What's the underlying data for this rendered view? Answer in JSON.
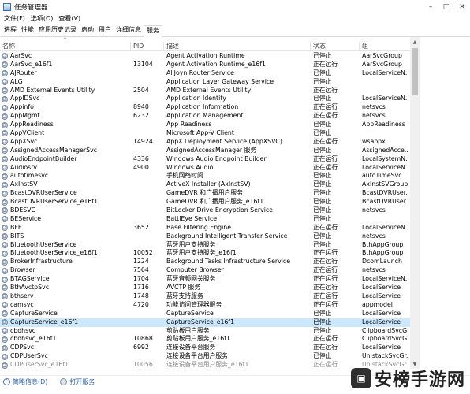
{
  "window": {
    "title": "任务管理器",
    "minimize": "–",
    "maximize": "□",
    "close": "✕"
  },
  "menu": [
    "文件(F)",
    "选项(O)",
    "查看(V)"
  ],
  "tabs": [
    {
      "label": "进程",
      "active": false
    },
    {
      "label": "性能",
      "active": false
    },
    {
      "label": "应用历史记录",
      "active": false
    },
    {
      "label": "启动",
      "active": false
    },
    {
      "label": "用户",
      "active": false
    },
    {
      "label": "详细信息",
      "active": false
    },
    {
      "label": "服务",
      "active": true
    }
  ],
  "columns": {
    "name": "名称",
    "pid": "PID",
    "desc": "描述",
    "status": "状态",
    "group": "组"
  },
  "sort_indicator": "^",
  "services": [
    {
      "name": "AarSvc",
      "pid": "",
      "desc": "Agent Activation Runtime",
      "status": "已停止",
      "group": "AarSvcGroup"
    },
    {
      "name": "AarSvc_e16f1",
      "pid": "13104",
      "desc": "Agent Activation Runtime_e16f1",
      "status": "正在运行",
      "group": "AarSvcGroup"
    },
    {
      "name": "AJRouter",
      "pid": "",
      "desc": "AllJoyn Router Service",
      "status": "已停止",
      "group": "LocalServiceN..."
    },
    {
      "name": "ALG",
      "pid": "",
      "desc": "Application Layer Gateway Service",
      "status": "已停止",
      "group": ""
    },
    {
      "name": "AMD External Events Utility",
      "pid": "2504",
      "desc": "AMD External Events Utility",
      "status": "正在运行",
      "group": ""
    },
    {
      "name": "AppIDSvc",
      "pid": "",
      "desc": "Application Identity",
      "status": "已停止",
      "group": "LocalServiceN..."
    },
    {
      "name": "Appinfo",
      "pid": "8940",
      "desc": "Application Information",
      "status": "正在运行",
      "group": "netsvcs"
    },
    {
      "name": "AppMgmt",
      "pid": "6232",
      "desc": "Application Management",
      "status": "正在运行",
      "group": "netsvcs"
    },
    {
      "name": "AppReadiness",
      "pid": "",
      "desc": "App Readiness",
      "status": "已停止",
      "group": "AppReadiness"
    },
    {
      "name": "AppVClient",
      "pid": "",
      "desc": "Microsoft App-V Client",
      "status": "已停止",
      "group": ""
    },
    {
      "name": "AppXSvc",
      "pid": "14924",
      "desc": "AppX Deployment Service (AppXSVC)",
      "status": "正在运行",
      "group": "wsappx"
    },
    {
      "name": "AssignedAccessManagerSvc",
      "pid": "",
      "desc": "AssignedAccessManager 服务",
      "status": "已停止",
      "group": "AssignedAcce..."
    },
    {
      "name": "AudioEndpointBuilder",
      "pid": "4336",
      "desc": "Windows Audio Endpoint Builder",
      "status": "正在运行",
      "group": "LocalSystemN..."
    },
    {
      "name": "Audiosrv",
      "pid": "4900",
      "desc": "Windows Audio",
      "status": "正在运行",
      "group": "LocalServiceN..."
    },
    {
      "name": "autotimesvc",
      "pid": "",
      "desc": "手机网络时间",
      "status": "已停止",
      "group": "autoTimeSvc"
    },
    {
      "name": "AxInstSV",
      "pid": "",
      "desc": "ActiveX Installer (AxInstSV)",
      "status": "已停止",
      "group": "AxInstSVGroup"
    },
    {
      "name": "BcastDVRUserService",
      "pid": "",
      "desc": "GameDVR 和广播用户服务",
      "status": "已停止",
      "group": "BcastDVRUser..."
    },
    {
      "name": "BcastDVRUserService_e16f1",
      "pid": "",
      "desc": "GameDVR 和广播用户服务_e16f1",
      "status": "已停止",
      "group": "BcastDVRUser..."
    },
    {
      "name": "BDESVC",
      "pid": "",
      "desc": "BitLocker Drive Encryption Service",
      "status": "已停止",
      "group": "netsvcs"
    },
    {
      "name": "BEService",
      "pid": "",
      "desc": "BattlEye Service",
      "status": "已停止",
      "group": ""
    },
    {
      "name": "BFE",
      "pid": "3652",
      "desc": "Base Filtering Engine",
      "status": "正在运行",
      "group": "LocalServiceN..."
    },
    {
      "name": "BITS",
      "pid": "",
      "desc": "Background Intelligent Transfer Service",
      "status": "已停止",
      "group": "netsvcs"
    },
    {
      "name": "BluetoothUserService",
      "pid": "",
      "desc": "蓝牙用户支持服务",
      "status": "已停止",
      "group": "BthAppGroup"
    },
    {
      "name": "BluetoothUserService_e16f1",
      "pid": "10052",
      "desc": "蓝牙用户支持服务_e16f1",
      "status": "正在运行",
      "group": "BthAppGroup"
    },
    {
      "name": "BrokerInfrastructure",
      "pid": "1224",
      "desc": "Background Tasks Infrastructure Service",
      "status": "正在运行",
      "group": "DcomLaunch"
    },
    {
      "name": "Browser",
      "pid": "7564",
      "desc": "Computer Browser",
      "status": "正在运行",
      "group": "netsvcs"
    },
    {
      "name": "BTAGService",
      "pid": "1704",
      "desc": "蓝牙音频网关服务",
      "status": "正在运行",
      "group": "LocalServiceN..."
    },
    {
      "name": "BthAvctpSvc",
      "pid": "1716",
      "desc": "AVCTP 服务",
      "status": "正在运行",
      "group": "LocalService"
    },
    {
      "name": "bthserv",
      "pid": "1748",
      "desc": "蓝牙支持服务",
      "status": "正在运行",
      "group": "LocalService"
    },
    {
      "name": "camsvc",
      "pid": "4720",
      "desc": "功能访问管理器服务",
      "status": "正在运行",
      "group": "appmodel"
    },
    {
      "name": "CaptureService",
      "pid": "",
      "desc": "CaptureService",
      "status": "已停止",
      "group": "LocalService"
    },
    {
      "name": "CaptureService_e16f1",
      "pid": "",
      "desc": "CaptureService_e16f1",
      "status": "已停止",
      "group": "LocalService",
      "selected": true
    },
    {
      "name": "cbdhsvc",
      "pid": "",
      "desc": "剪贴板用户服务",
      "status": "已停止",
      "group": "ClipboardSvcG..."
    },
    {
      "name": "cbdhsvc_e16f1",
      "pid": "10868",
      "desc": "剪贴板用户服务_e16f1",
      "status": "正在运行",
      "group": "ClipboardSvcG..."
    },
    {
      "name": "CDPSvc",
      "pid": "6992",
      "desc": "连接设备平台服务",
      "status": "正在运行",
      "group": "LocalService"
    },
    {
      "name": "CDPUserSvc",
      "pid": "",
      "desc": "连接设备平台用户服务",
      "status": "已停止",
      "group": "UnistackSvcGr..."
    },
    {
      "name": "CDPUserSvc_e16f1",
      "pid": "10056",
      "desc": "连接设备平台用户服务_e16f1",
      "status": "正在运行",
      "group": "UnistackSvcGr...",
      "faded": true
    }
  ],
  "statusbar": {
    "brief_label": "简略信息(D)",
    "open_services_label": "打开服务"
  },
  "watermark": {
    "text": "安榜手游网"
  }
}
